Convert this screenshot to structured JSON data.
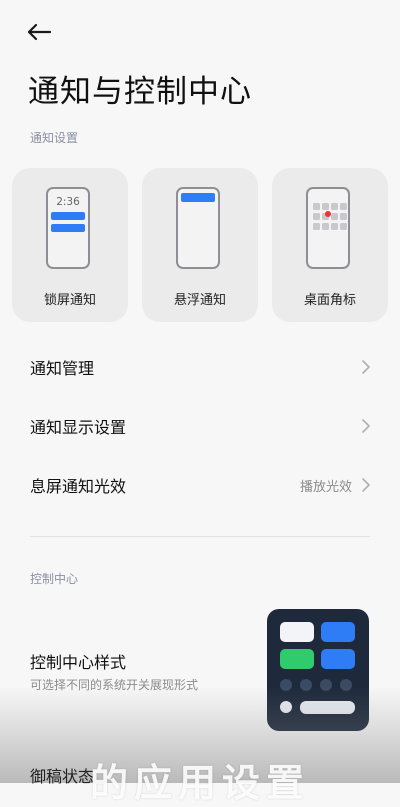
{
  "header": {
    "title": "通知与控制中心"
  },
  "notification_section": {
    "header": "通知设置",
    "cards": [
      {
        "label": "锁屏通知",
        "time": "2:36"
      },
      {
        "label": "悬浮通知"
      },
      {
        "label": "桌面角标"
      }
    ]
  },
  "rows": [
    {
      "label": "通知管理",
      "value": ""
    },
    {
      "label": "通知显示设置",
      "value": ""
    },
    {
      "label": "息屏通知光效",
      "value": "播放光效"
    }
  ],
  "control_center": {
    "header": "控制中心",
    "style_title": "控制中心样式",
    "style_subtitle": "可选择不同的系统开关展现形式"
  },
  "partial_row_label": "御稿状态",
  "overlay_subtitle": "的应用设置",
  "colors": {
    "accent_blue": "#2f7df6",
    "accent_green": "#2fcb6c",
    "badge_red": "#f23131",
    "background": "#f7f7f7"
  }
}
